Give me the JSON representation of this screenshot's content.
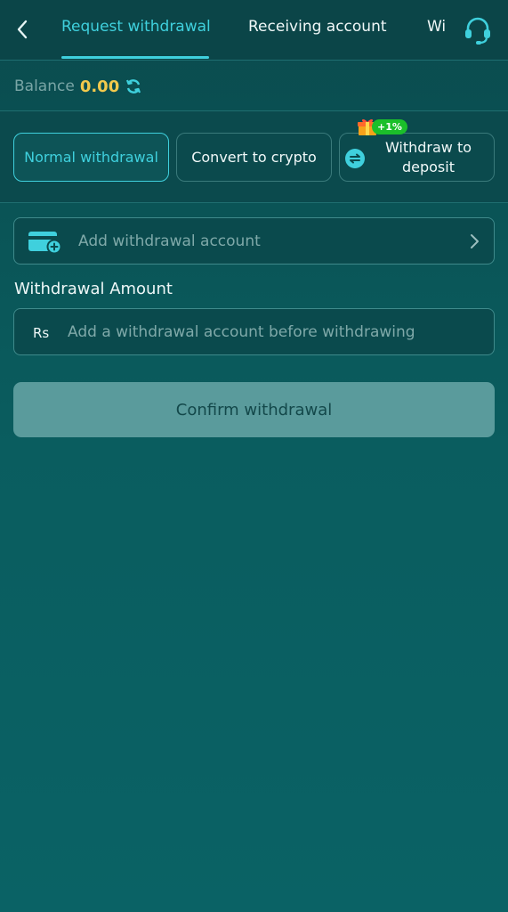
{
  "header": {
    "tabs": [
      {
        "label": "Request withdrawal",
        "active": true
      },
      {
        "label": "Receiving account",
        "active": false
      },
      {
        "label": "Wi",
        "active": false
      }
    ],
    "back_icon": "chevron-left-icon",
    "support_icon": "headset-icon"
  },
  "balance": {
    "label": "Balance",
    "value": "0.00",
    "refresh_icon": "refresh-icon"
  },
  "methods": [
    {
      "label": "Normal withdrawal",
      "active": true
    },
    {
      "label": "Convert to crypto",
      "active": false
    },
    {
      "label_line1": "Withdraw to",
      "label_line2": "deposit",
      "active": false,
      "icon": "swap-icon",
      "badge": "+1%",
      "badge_icon": "gift-icon"
    }
  ],
  "add_account": {
    "label": "Add withdrawal account",
    "icon": "card-add-icon"
  },
  "amount": {
    "title": "Withdrawal Amount",
    "currency": "Rs",
    "placeholder": "Add a withdrawal account before withdrawing"
  },
  "confirm": {
    "label": "Confirm withdrawal"
  },
  "colors": {
    "accent": "#3fd0dd",
    "balance": "#f2c94c",
    "background": "#0a5e60",
    "badge": "#1bbf2a"
  }
}
